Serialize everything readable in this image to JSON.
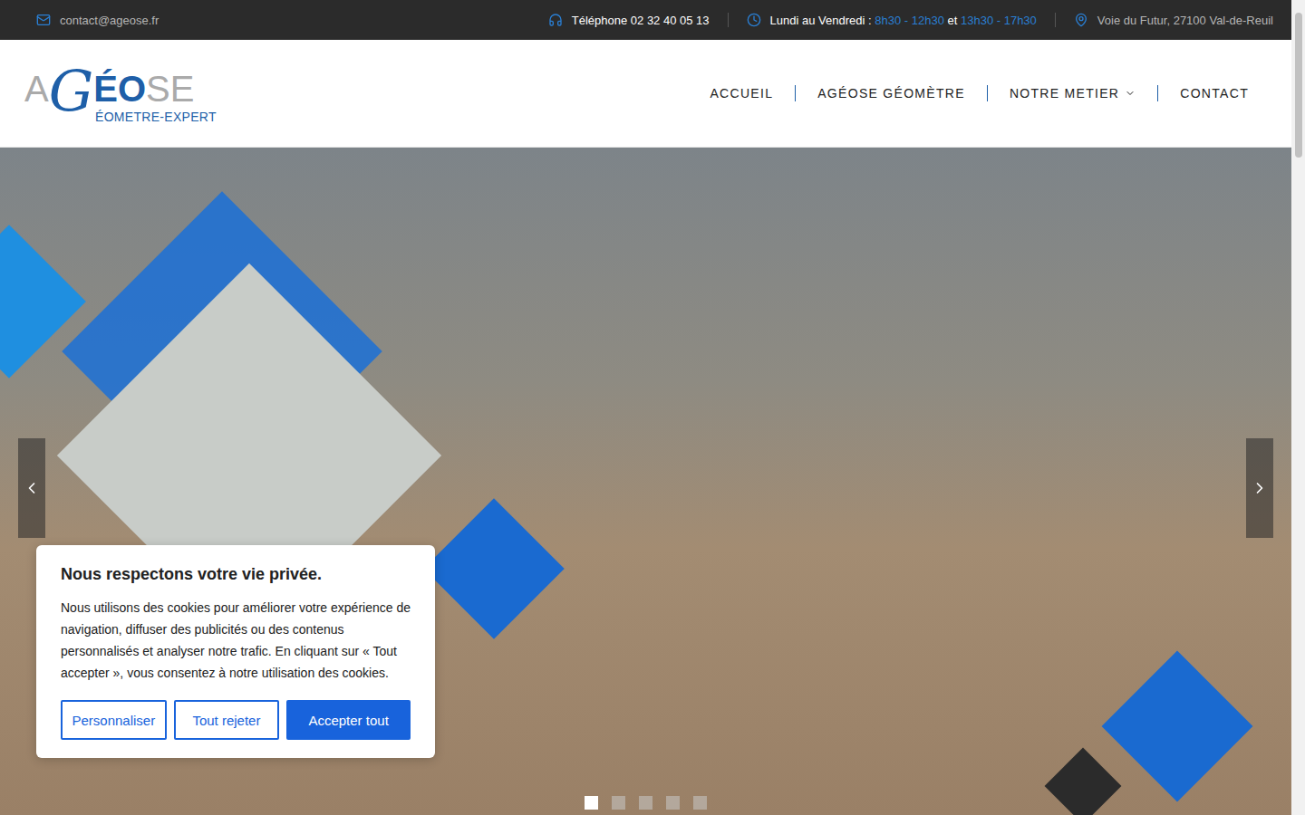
{
  "topbar": {
    "email": "contact@ageose.fr",
    "phone": "Téléphone 02 32 40 05 13",
    "hours": {
      "label": "Lundi au Vendredi :",
      "morning": "8h30 - 12h30",
      "joiner": "et",
      "afternoon": "13h30 - 17h30"
    },
    "address": "Voie du Futur, 27100 Val-de-Reuil"
  },
  "logo": {
    "letters": [
      "A",
      "G",
      "ÉO",
      "SE"
    ],
    "subtitle": "ÉOMETRE-EXPERT"
  },
  "nav": [
    {
      "label": "ACCUEIL",
      "dropdown": false
    },
    {
      "label": "AGÉOSE GÉOMÈTRE",
      "dropdown": false
    },
    {
      "label": "NOTRE METIER",
      "dropdown": true
    },
    {
      "label": "CONTACT",
      "dropdown": false
    }
  ],
  "slider": {
    "dots": [
      {
        "selected": true
      },
      {
        "selected": false
      },
      {
        "selected": false
      },
      {
        "selected": false
      },
      {
        "selected": false
      }
    ]
  },
  "cookie": {
    "title": "Nous respectons votre vie privée.",
    "text": "Nous utilisons des cookies pour améliorer votre expérience de navigation, diffuser des publicités ou des contenus personnalisés et analyser notre trafic. En cliquant sur « Tout accepter », vous consentez à notre utilisation des cookies.",
    "buttons": [
      {
        "label": "Personnaliser",
        "primary": false
      },
      {
        "label": "Tout rejeter",
        "primary": false
      },
      {
        "label": "Accepter tout",
        "primary": true
      }
    ]
  }
}
